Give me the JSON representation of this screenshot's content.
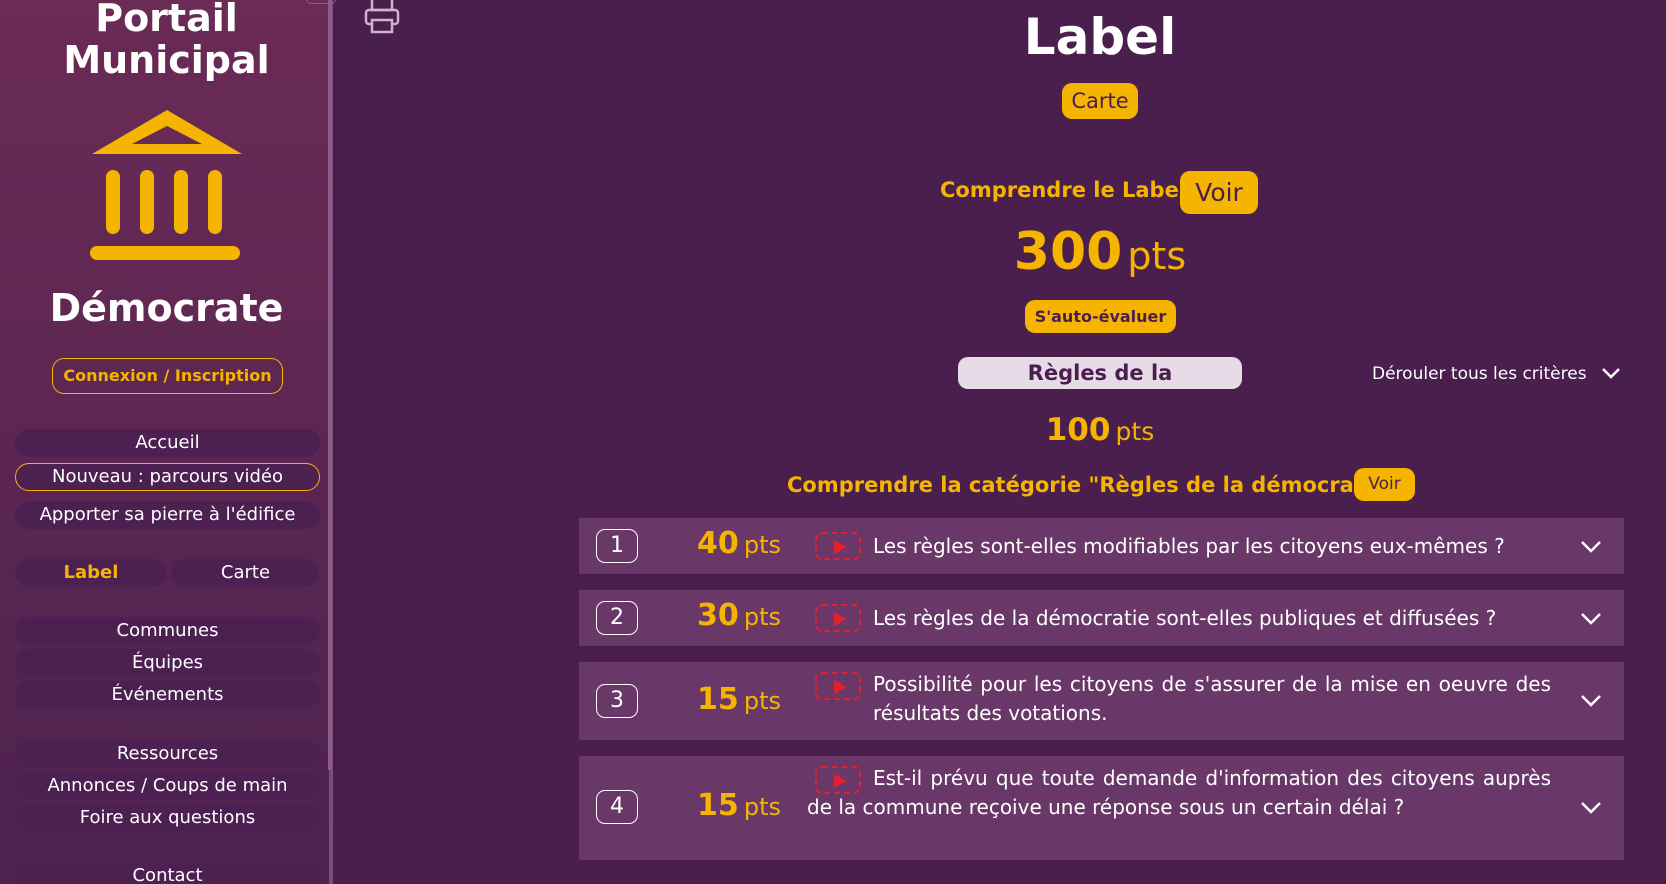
{
  "sidebar": {
    "title_line1": "Portail",
    "title_line2": "Municipal",
    "logo_icon": "town-hall-icon",
    "brand_name": "Démocrate",
    "login_label": "Connexion / Inscription",
    "nav_group1": [
      "Accueil",
      "Nouveau : parcours vidéo",
      "Apporter sa pierre à l'édifice"
    ],
    "label_tab": "Label",
    "map_tab": "Carte",
    "nav_group2": [
      "Communes",
      "Équipes",
      "Événements"
    ],
    "nav_group3": [
      "Ressources",
      "Annonces / Coups de main",
      "Foire aux questions"
    ],
    "contact": "Contact"
  },
  "main": {
    "print_icon": "printer-icon",
    "title": "Label",
    "map_button": "Carte",
    "understand_label": "Comprendre le Label",
    "view_button": "Voir",
    "total_points": "300",
    "points_unit": "pts",
    "self_assess_button": "S'auto-évaluer",
    "category_name": "Règles de la démocratie",
    "expand_all": "Dérouler tous les critères",
    "category_points": "100",
    "understand_category": "Comprendre la catégorie \"Règles de la démocratie\"",
    "view_category_button": "Voir"
  },
  "criteria": [
    {
      "number": "1",
      "points": "40",
      "unit": "pts",
      "text": "Les règles sont-elles modifiables par les citoyens eux-mêmes ?"
    },
    {
      "number": "2",
      "points": "30",
      "unit": "pts",
      "text": "Les règles de la démocratie sont-elles publiques et diffusées ?"
    },
    {
      "number": "3",
      "points": "15",
      "unit": "pts",
      "text": "Possibilité pour les citoyens de s'assurer de la mise en oeuvre des résultats des votations."
    },
    {
      "number": "4",
      "points": "15",
      "unit": "pts",
      "text": "Est-il prévu que toute demande d'information des citoyens auprès de la commune reçoive une réponse sous un certain délai ?"
    }
  ],
  "colors": {
    "background": "#4a1f4e",
    "accent": "#f5b400",
    "criterion_bg": "#6a3868",
    "video_icon": "#e0202e"
  }
}
